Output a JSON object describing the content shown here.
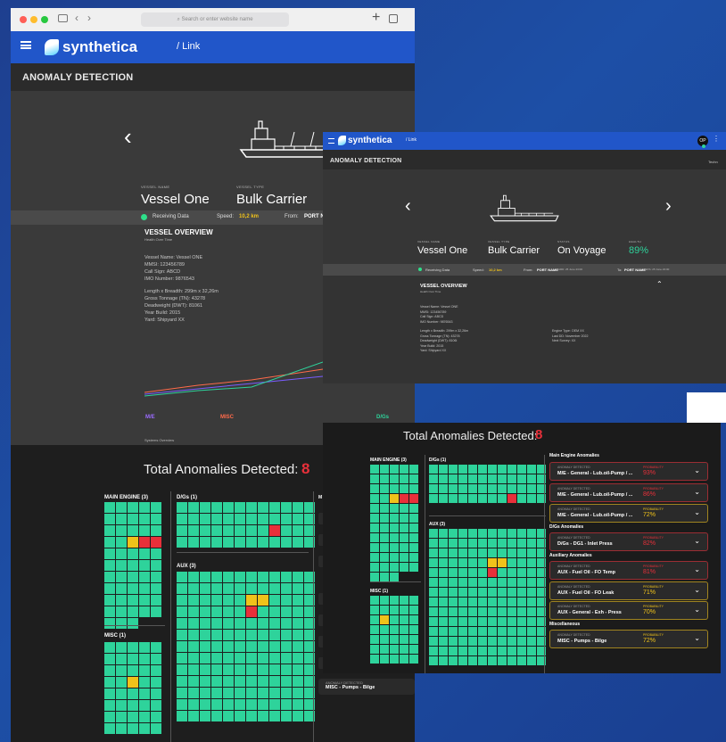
{
  "browser": {
    "search_placeholder": "Search or enter website name",
    "breadcrumb": "/ Link"
  },
  "brand": "synthetica",
  "section_title": "ANOMALY DETECTION",
  "vessel": {
    "name_label": "VESSEL NAME",
    "name": "Vessel One",
    "type_label": "VESSEL TYPE",
    "type": "Bulk Carrier",
    "status_label": "STATUS",
    "status": "On Voyage",
    "health_label": "HEALTH",
    "health": "89%"
  },
  "status_bar": {
    "receiving": "Receiving Data",
    "speed_label": "Speed:",
    "speed": "10,2 km",
    "from_label": "From:",
    "from": "PORT NAME",
    "from_eta": "ARD: 25 June 23:00",
    "to_label": "To:",
    "to": "PORT NAME",
    "to_eta": "ETA: 25 June 23:00",
    "truncated_from": "PORT N"
  },
  "overview": {
    "title": "VESSEL OVERVIEW",
    "subtitle": "Health Over Time",
    "lines1": [
      "Vessel Name: Vessel ONE",
      "MMSI: 123456789",
      "Call Sign: ABCD",
      "IMO Number: 9876543"
    ],
    "lines2": [
      "Length x Breadth: 299m x 32,26m",
      "Gross Tonnage (TN): 43278",
      "Deadweight (DWT): 81061",
      "Year Build: 2015",
      "Yard: Shipyard XX"
    ],
    "lines2_front": [
      "Length x Breadth: 299m x 32,26m",
      "Gross Tonnage (TN): 43278",
      "Deadweight (DWT): 8106l",
      "Year Build: 2015",
      "Yard: Shipyard XX"
    ],
    "engine": [
      "Engine Type: OEM XX",
      "Last DD: November 2022",
      "Next Survey: XX"
    ],
    "legend": [
      "M/E",
      "MISC",
      "D/Gs"
    ],
    "systems_overview": "Systems Overview"
  },
  "user_initials": "OP",
  "tab_cut": "Techn",
  "anomalies": {
    "title": "Total Anomalies Detected:",
    "count": "8",
    "groups": {
      "me": "MAIN ENGINE (3)",
      "dg": "D/Gs (1)",
      "aux": "AUX (3)",
      "misc": "MISC (1)"
    },
    "sections": [
      "Main Engine Anomalies",
      "D/Gs Anomalies",
      "Auxiliary Anomalies",
      "Miscellaneous"
    ],
    "detected_label": "ANOMALY DETECTED",
    "prob_label": "PROBABILITY",
    "items": [
      {
        "name": "M/E - General - Lub.oil-Pump / ...",
        "prob": "93%",
        "color": "#e8303a"
      },
      {
        "name": "M/E - General - Lub.oil-Pump / ...",
        "prob": "86%",
        "color": "#e8303a"
      },
      {
        "name": "M/E - General - Lub.oil-Pump / ...",
        "prob": "72%",
        "color": "#f0c21a"
      },
      {
        "name": "D/Gs - DG1 - Inlet Press",
        "prob": "82%",
        "color": "#e8303a"
      },
      {
        "name": "AUX - Fuel Oil - FO Temp",
        "prob": "81%",
        "color": "#e8303a"
      },
      {
        "name": "AUX - Fuel Oil - FO Leak",
        "prob": "71%",
        "color": "#f0c21a"
      },
      {
        "name": "AUX - General - Exh - Press",
        "prob": "70%",
        "color": "#f0c21a"
      },
      {
        "name": "MISC - Pumps - Bilge",
        "prob": "72%",
        "color": "#f0c21a"
      }
    ],
    "back_partial": {
      "group_cut": "M",
      "misc_item": "MISC - Pumps - Bilge"
    }
  },
  "colors": {
    "ok": "#2ed39b",
    "warn": "#f0c21a",
    "alert": "#e8303a",
    "nav": "#2156c9"
  }
}
